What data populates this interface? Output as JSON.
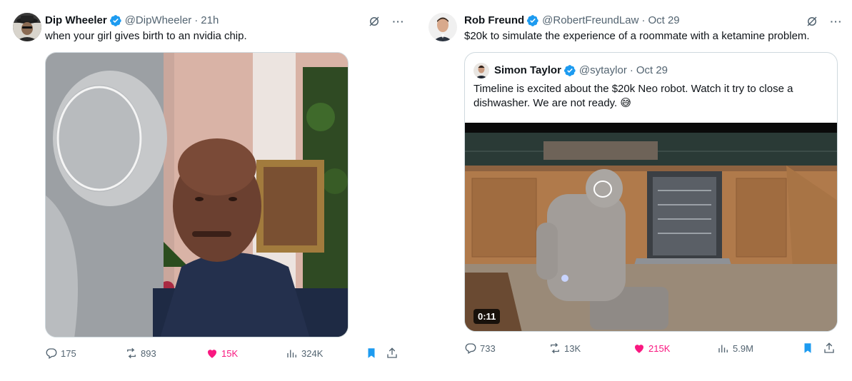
{
  "tweets": [
    {
      "author": {
        "name": "Dip Wheeler",
        "handle": "@DipWheeler",
        "time": "21h"
      },
      "text": "when your girl gives birth to an nvidia chip.",
      "stats": {
        "replies": "175",
        "reposts": "893",
        "likes": "15K",
        "views": "324K"
      }
    },
    {
      "author": {
        "name": "Rob Freund",
        "handle": "@RobertFreundLaw",
        "time": "Oct 29"
      },
      "text": "$20k to simulate the experience of a roommate with a ketamine problem.",
      "quote": {
        "author": {
          "name": "Simon Taylor",
          "handle": "@sytaylor",
          "time": "Oct 29"
        },
        "text_line1": "Timeline is excited about the $20k Neo robot. Watch it try to close a",
        "text_line2": "dishwasher. We are not ready.",
        "emoji": "😅",
        "video_duration": "0:11"
      },
      "stats": {
        "replies": "733",
        "reposts": "13K",
        "likes": "215K",
        "views": "5.9M"
      }
    }
  ],
  "ui": {
    "dot": "·",
    "more": "···"
  },
  "colors": {
    "accent": "#1d9bf0",
    "like": "#f91880",
    "secondary": "#536471"
  }
}
